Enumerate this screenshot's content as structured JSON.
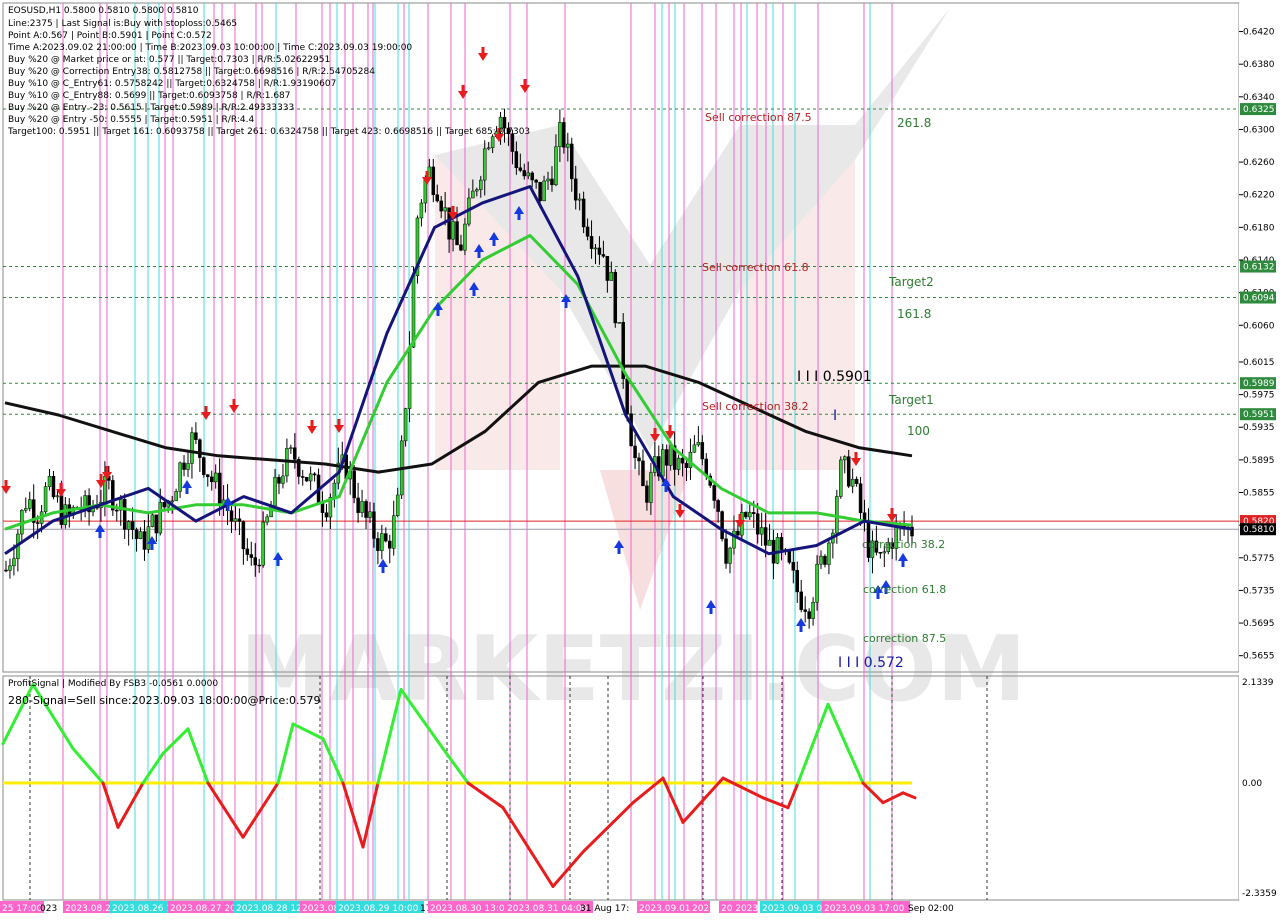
{
  "info": {
    "lines": [
      "EOSUSD,H1  0.5800 0.5810 0.5800 0.5810",
      "Line:2375 | Last Signal is:Buy with stoploss:0.5465",
      "Point A:0.567 | Point B:0.5901 | Point C:0.572",
      "Time A:2023.09.02 21:00:00 | Time B:2023.09.03 10:00:00 | Time C:2023.09.03 19:00:00",
      "Buy %20 @ Market price or at: 0.577 || Target:0.7303 | R/R:5.02622951",
      "Buy %20 @ Correction Entry38: 0.5812758 || Target:0.6698516 | R/R:2.54705284",
      "Buy %10 @ C_Entry61: 0.5758242 || Target:0.6324758 | R/R:1.93190607",
      "Buy %10 @ C_Entry88: 0.5699 || Target:0.6093758 | R/R:1.687",
      "Buy %20 @ Entry -23: 0.5615 | Target:0.5989 | R/R:2.49333333",
      "Buy %20 @ Entry -50: 0.5555 | Target:0.5951 | R/R:4.4",
      "Target100: 0.5951 || Target 161: 0.6093758 || Target 261: 0.6324758 || Target 423: 0.6698516 || Target 685: 0.7303"
    ]
  },
  "levels": [
    {
      "label": "Sell correction 87.5",
      "color": "#b22222"
    },
    {
      "label": "Sell correction 61.8",
      "color": "#b22222"
    },
    {
      "label": "Sell correction 38.2",
      "color": "#b22222"
    },
    {
      "label": "261.8",
      "color": "#2e7d32"
    },
    {
      "label": "Target2",
      "color": "#2e7d32"
    },
    {
      "label": "161.8",
      "color": "#2e7d32"
    },
    {
      "label": "Target1",
      "color": "#2e7d32"
    },
    {
      "label": "100",
      "color": "#2e7d32"
    },
    {
      "label": "correction 38.2",
      "color": "#2e7d32"
    },
    {
      "label": "correction 61.8",
      "color": "#2e7d32"
    },
    {
      "label": "correction 87.5",
      "color": "#2e7d32"
    },
    {
      "label": "I I I 0.5901",
      "color": "#000000"
    },
    {
      "label": "I I I 0.572",
      "color": "#1a1aa6"
    },
    {
      "label": "I",
      "color": "#1a1aa6"
    }
  ],
  "price_tags": [
    {
      "value": "0.6325",
      "bg": "#2e8b3d"
    },
    {
      "value": "0.6132",
      "bg": "#2e8b3d"
    },
    {
      "value": "0.6094",
      "bg": "#2e8b3d"
    },
    {
      "value": "0.5989",
      "bg": "#2e8b3d"
    },
    {
      "value": "0.5951",
      "bg": "#2e8b3d"
    },
    {
      "value": "0.5820",
      "bg": "#e02020"
    },
    {
      "value": "0.5810",
      "bg": "#000000"
    }
  ],
  "indicator": {
    "title": "ProfitSignal | Modified By FSB3 -0.0561 0.0000",
    "signal": "280-Signal=Sell since:2023.09.03 18:00:00@Price:0.579",
    "axis_ticks": [
      "2.1339",
      "0.00",
      "-2.3359"
    ]
  },
  "x_labels": [
    {
      "text": "25 17:00",
      "bg": "#ff66cc"
    },
    {
      "text": "023",
      "bg": ""
    },
    {
      "text": "2023.08.2",
      "bg": "#ff66cc"
    },
    {
      "text": "2023.08.26 1",
      "bg": "#33dddd"
    },
    {
      "text": "2023.08.27 20:",
      "bg": "#ff66cc"
    },
    {
      "text": "2023.08.28 12:",
      "bg": "#33dddd"
    },
    {
      "text": "2023.08.",
      "bg": "#ff66cc"
    },
    {
      "text": "2023.08.29 10:00",
      "bg": "#33dddd"
    },
    {
      "text": "17",
      "bg": ""
    },
    {
      "text": "2023.08.30 13:00",
      "bg": "#ff66cc"
    },
    {
      "text": "2023.08.31 04:00",
      "bg": "#ff66cc"
    },
    {
      "text": "31 Aug 17:",
      "bg": ""
    },
    {
      "text": "2023.09.01",
      "bg": "#ff66cc"
    },
    {
      "text": "202",
      "bg": "#ff66cc"
    },
    {
      "text": "20 2023",
      "bg": "#ff66cc"
    },
    {
      "text": "2023.09.03 00:",
      "bg": "#33dddd"
    },
    {
      "text": "2023.09.03 17:00",
      "bg": "#ff66cc"
    },
    {
      "text": "Sep 02:00",
      "bg": ""
    }
  ],
  "chart_data": {
    "type": "candlestick",
    "symbol": "EOSUSD",
    "timeframe": "H1",
    "ylim": [
      0.5635,
      0.6455
    ],
    "y_ticks": [
      0.642,
      0.638,
      0.634,
      0.63,
      0.626,
      0.622,
      0.618,
      0.614,
      0.61,
      0.606,
      0.6015,
      0.5975,
      0.5935,
      0.5895,
      0.5855,
      0.5815,
      0.5775,
      0.5735,
      0.5695,
      0.5655
    ],
    "horizontal_levels": [
      0.6325,
      0.6132,
      0.6094,
      0.5989,
      0.5951,
      0.582,
      0.581
    ],
    "close_path": [
      0.576,
      0.58,
      0.585,
      0.583,
      0.586,
      0.584,
      0.582,
      0.584,
      0.583,
      0.585,
      0.586,
      0.584,
      0.582,
      0.579,
      0.581,
      0.583,
      0.585,
      0.589,
      0.592,
      0.59,
      0.587,
      0.585,
      0.582,
      0.579,
      0.576,
      0.58,
      0.585,
      0.589,
      0.59,
      0.588,
      0.586,
      0.584,
      0.587,
      0.589,
      0.585,
      0.582,
      0.58,
      0.579,
      0.583,
      0.6,
      0.62,
      0.625,
      0.623,
      0.618,
      0.615,
      0.62,
      0.625,
      0.63,
      0.632,
      0.628,
      0.625,
      0.623,
      0.622,
      0.625,
      0.63,
      0.624,
      0.62,
      0.617,
      0.615,
      0.61,
      0.6,
      0.59,
      0.585,
      0.588,
      0.59,
      0.589,
      0.588,
      0.591,
      0.589,
      0.585,
      0.578,
      0.58,
      0.583,
      0.581,
      0.579,
      0.578,
      0.576,
      0.573,
      0.572,
      0.576,
      0.58,
      0.588,
      0.588,
      0.583,
      0.578,
      0.577,
      0.58,
      0.581,
      0.581
    ],
    "ma_black": [
      0.5965,
      0.595,
      0.593,
      0.591,
      0.59,
      0.5895,
      0.589,
      0.588,
      0.589,
      0.593,
      0.599,
      0.601,
      0.601,
      0.599,
      0.596,
      0.593,
      0.591,
      0.59
    ],
    "ma_blue": [
      0.578,
      0.582,
      0.584,
      0.586,
      0.582,
      0.585,
      0.583,
      0.588,
      0.605,
      0.618,
      0.621,
      0.623,
      0.612,
      0.595,
      0.585,
      0.581,
      0.578,
      0.579,
      0.582,
      0.581
    ],
    "ma_green": [
      0.581,
      0.583,
      0.584,
      0.583,
      0.584,
      0.584,
      0.583,
      0.585,
      0.599,
      0.608,
      0.614,
      0.617,
      0.611,
      0.6,
      0.591,
      0.586,
      0.583,
      0.583,
      0.582,
      0.5815
    ],
    "oscillator": {
      "range": [
        -2.3359,
        2.1339
      ],
      "zero": 0.0
    }
  }
}
